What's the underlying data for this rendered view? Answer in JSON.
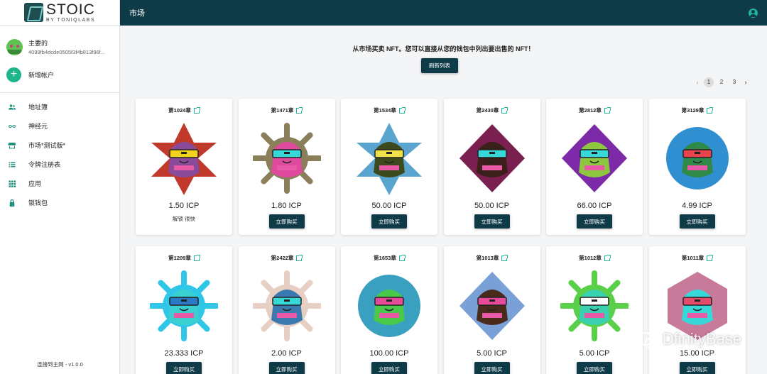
{
  "sidebar": {
    "logo_name": "STOIC",
    "logo_sub": "BY TONIQLABS",
    "account": {
      "name": "主要的",
      "address": "4099fb4dcde0505f3f4b813f96f..."
    },
    "add_account": "新增帐户",
    "nav": [
      {
        "label": "地址簿",
        "icon": "contacts-icon"
      },
      {
        "label": "神经元",
        "icon": "infinity-icon"
      },
      {
        "label": "市场*测试版*",
        "icon": "store-icon"
      },
      {
        "label": "令牌注册表",
        "icon": "list-icon"
      },
      {
        "label": "应用",
        "icon": "apps-grid-icon"
      },
      {
        "label": "锁钱包",
        "icon": "lock-icon"
      }
    ],
    "footer": "连接到主网 - v1.0.0"
  },
  "header": {
    "title": "市场"
  },
  "main": {
    "intro": "从市场买卖 NFT。您可以直接从您的钱包中列出要出售的 NFT！",
    "refresh": "刷新列表",
    "pages": [
      "1",
      "2",
      "3"
    ],
    "active_page": "1",
    "buy_label": "立即购买"
  },
  "cards": [
    {
      "title": "第1024章",
      "price": "1.50 ICP",
      "note": "解锁 很快",
      "bg": "#c0392b",
      "skin": "#8a4a9a",
      "glass": "#f2d21b"
    },
    {
      "title": "第1471章",
      "price": "1.80 ICP",
      "bg": "#8a7f5a",
      "skin": "#e04a9e",
      "glass": "#38d8d8"
    },
    {
      "title": "第1534章",
      "price": "50.00 ICP",
      "bg": "#5aa5d0",
      "skin": "#3d4a1e",
      "glass": "#f0e04a"
    },
    {
      "title": "第2430章",
      "price": "50.00 ICP",
      "bg": "#7a2050",
      "skin": "#3a1f1a",
      "glass": "#38d8d8"
    },
    {
      "title": "第2812章",
      "price": "66.00 ICP",
      "bg": "#7d2aa8",
      "skin": "#8dc63f",
      "glass": "#38d8d8"
    },
    {
      "title": "第3129章",
      "price": "4.99 ICP",
      "bg": "#2f8fd0",
      "skin": "#2f8a4a",
      "glass": "#e8434a"
    },
    {
      "title": "第1209章",
      "price": "23.333 ICP",
      "bg": "#2fc6e8",
      "skin": "#3ad0d0",
      "glass": "#2a7ac8"
    },
    {
      "title": "第2422章",
      "price": "2.00 ICP",
      "bg": "#e8cfc4",
      "skin": "#3a7ab0",
      "glass": "#38d8d8"
    },
    {
      "title": "第1653章",
      "price": "100.00 ICP",
      "bg": "#3aa0c0",
      "skin": "#4ac84a",
      "glass": "#e84a9a"
    },
    {
      "title": "第1013章",
      "price": "5.00 ICP",
      "bg": "#7aa0d8",
      "skin": "#4a2a1a",
      "glass": "#e84a9a"
    },
    {
      "title": "第1012章",
      "price": "5.00 ICP",
      "bg": "#5ad04a",
      "skin": "#3ad0b0",
      "glass": "#ffffff"
    },
    {
      "title": "第1011章",
      "price": "15.00 ICP",
      "bg": "#c87a9a",
      "skin": "#38d8d8",
      "glass": "#e84a6a"
    }
  ],
  "watermark": "DfinityBase"
}
